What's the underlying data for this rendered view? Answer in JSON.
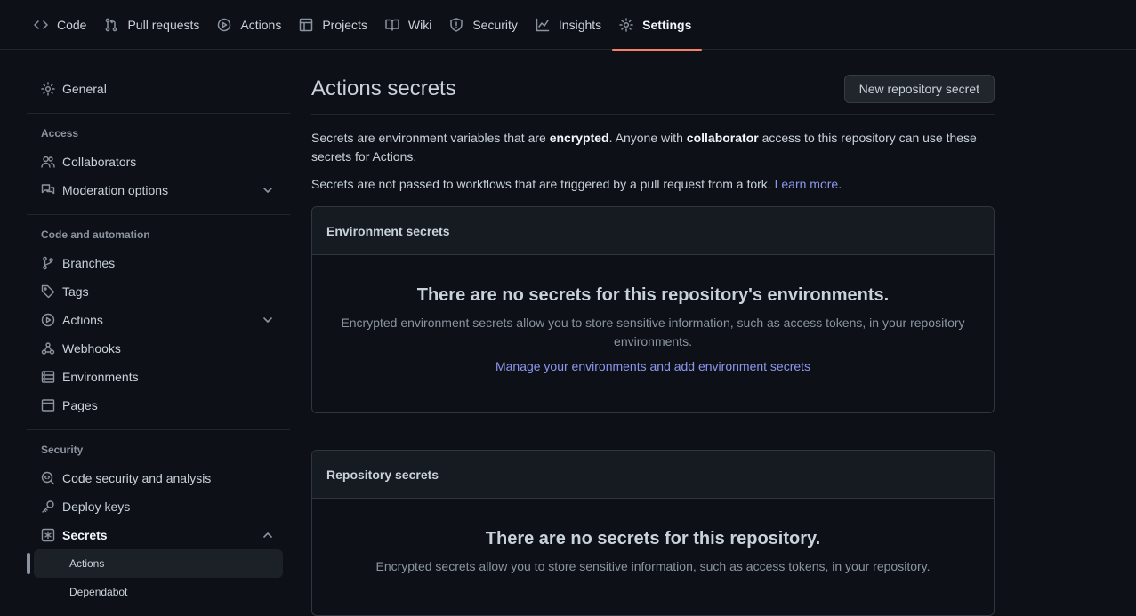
{
  "nav": {
    "tabs": [
      {
        "label": "Code",
        "icon": "code-icon"
      },
      {
        "label": "Pull requests",
        "icon": "pull-request-icon"
      },
      {
        "label": "Actions",
        "icon": "play-icon"
      },
      {
        "label": "Projects",
        "icon": "table-icon"
      },
      {
        "label": "Wiki",
        "icon": "book-icon"
      },
      {
        "label": "Security",
        "icon": "shield-icon"
      },
      {
        "label": "Insights",
        "icon": "graph-icon"
      },
      {
        "label": "Settings",
        "icon": "gear-icon",
        "active": true
      }
    ]
  },
  "sidebar": {
    "general": "General",
    "access_heading": "Access",
    "collaborators": "Collaborators",
    "moderation": "Moderation options",
    "code_heading": "Code and automation",
    "branches": "Branches",
    "tags": "Tags",
    "actions": "Actions",
    "webhooks": "Webhooks",
    "environments": "Environments",
    "pages": "Pages",
    "security_heading": "Security",
    "code_security": "Code security and analysis",
    "deploy_keys": "Deploy keys",
    "secrets": "Secrets",
    "secrets_actions": "Actions",
    "secrets_dependabot": "Dependabot"
  },
  "main": {
    "title": "Actions secrets",
    "new_button": "New repository secret",
    "desc_part1": "Secrets are environment variables that are ",
    "desc_bold1": "encrypted",
    "desc_part2": ". Anyone with ",
    "desc_bold2": "collaborator",
    "desc_part3": " access to this repository can use these secrets for Actions.",
    "desc2_text": "Secrets are not passed to workflows that are triggered by a pull request from a fork. ",
    "learn_more": "Learn more",
    "desc2_end": ".",
    "env_box": {
      "heading": "Environment secrets",
      "blank_title": "There are no secrets for this repository's environments.",
      "blank_text": "Encrypted environment secrets allow you to store sensitive information, such as access tokens, in your repository environments.",
      "link": "Manage your environments and add environment secrets"
    },
    "repo_box": {
      "heading": "Repository secrets",
      "blank_title": "There are no secrets for this repository.",
      "blank_text": "Encrypted secrets allow you to store sensitive information, such as access tokens, in your repository."
    }
  },
  "colors": {
    "background": "#0d1117",
    "accent_underline": "#f78166",
    "link": "#8c96ec"
  }
}
